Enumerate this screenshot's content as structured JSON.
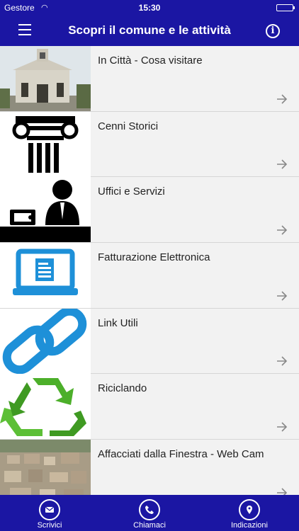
{
  "status_bar": {
    "carrier": "Gestore",
    "time": "15:30"
  },
  "header": {
    "title": "Scopri il comune e le attività"
  },
  "icons": {
    "menu": "menu-icon",
    "info": "info-icon",
    "row_chevron": "arrow-right-icon"
  },
  "list": {
    "items": [
      {
        "title": "In Città - Cosa visitare",
        "icon": "church-photo"
      },
      {
        "title": "Cenni Storici",
        "icon": "column-icon"
      },
      {
        "title": "Uffici e Servizi",
        "icon": "office-clerk-icon"
      },
      {
        "title": "Fatturazione Elettronica",
        "icon": "laptop-document-icon"
      },
      {
        "title": "Link Utili",
        "icon": "chain-link-icon"
      },
      {
        "title": "Riciclando",
        "icon": "recycle-icon"
      },
      {
        "title": "Affacciati dalla Finestra - Web Cam",
        "icon": "aerial-photo"
      }
    ]
  },
  "tabbar": {
    "items": [
      {
        "label": "Scrivici",
        "icon": "envelope-icon"
      },
      {
        "label": "Chiamaci",
        "icon": "phone-icon"
      },
      {
        "label": "Indicazioni",
        "icon": "map-pin-icon"
      }
    ]
  },
  "colors": {
    "brand": "#1b16a3",
    "background": "#f2f2f2",
    "text": "#222222",
    "link_blue": "#1e90d8",
    "recycle_green": "#4caf2a"
  }
}
